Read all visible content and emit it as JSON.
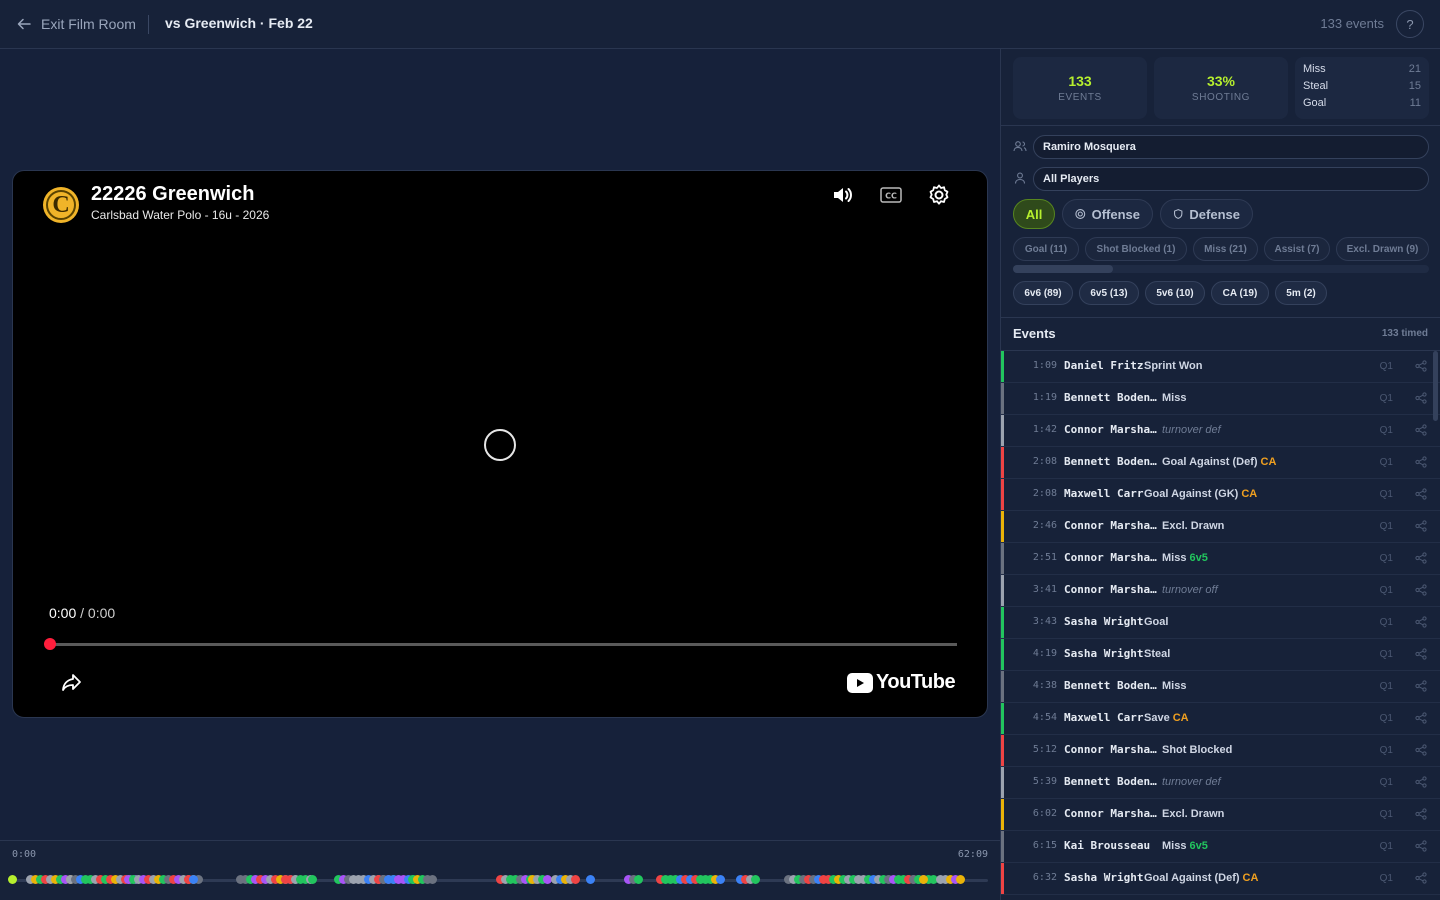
{
  "topbar": {
    "exit_label": "Exit Film Room",
    "game_title": "vs Greenwich · Feb 22",
    "events_count": "133 events",
    "help_label": "?"
  },
  "video": {
    "logo_letter": "C",
    "title": "22226 Greenwich",
    "subtitle": "Carlsbad Water Polo - 16u - 2026",
    "current_time": "0:00",
    "time_separator": "/",
    "duration": "0:00",
    "brand": "YouTube",
    "cc_label": "CC",
    "progress_fraction": 0
  },
  "timeline": {
    "start": "0:00",
    "end": "62:09"
  },
  "stats": {
    "events_value": "133",
    "events_label": "EVENTS",
    "shooting_value": "33%",
    "shooting_label": "SHOOTING",
    "breakdown": [
      {
        "name": "Miss",
        "count": "21"
      },
      {
        "name": "Steal",
        "count": "15"
      },
      {
        "name": "Goal",
        "count": "11"
      }
    ]
  },
  "filters": {
    "team_player": "Ramiro Mosquera",
    "player": "All Players"
  },
  "segments": {
    "all": "All",
    "offense": "Offense",
    "defense": "Defense"
  },
  "type_chips": [
    "Goal (11)",
    "Shot Blocked (1)",
    "Miss (21)",
    "Assist (7)",
    "Excl. Drawn (9)"
  ],
  "situation_chips": [
    "6v6 (89)",
    "6v5 (13)",
    "5v6 (10)",
    "CA (19)",
    "5m (2)"
  ],
  "events_header": {
    "title": "Events",
    "timed": "133 timed"
  },
  "colors": {
    "accent": "#b6ef2e",
    "green": "#22c55e",
    "red": "#ef4444",
    "amber": "#eab308",
    "gray": "#6b7280",
    "light_gray": "#9ca3af",
    "orange": "#f0a020"
  },
  "events": [
    {
      "time": "1:09",
      "player": "Daniel Fritz",
      "action": "Sprint Won",
      "tag": "",
      "tag_type": "",
      "italic": false,
      "quarter": "Q1",
      "color": "#22c55e"
    },
    {
      "time": "1:19",
      "player": "Bennett Boden…",
      "action": "Miss",
      "tag": "",
      "tag_type": "",
      "italic": false,
      "quarter": "Q1",
      "color": "#6b7280"
    },
    {
      "time": "1:42",
      "player": "Connor Marsha…",
      "action": "turnover def",
      "tag": "",
      "tag_type": "",
      "italic": true,
      "quarter": "Q1",
      "color": "#9ca3af"
    },
    {
      "time": "2:08",
      "player": "Bennett Boden…",
      "action": "Goal Against (Def)",
      "tag": "CA",
      "tag_type": "ca",
      "italic": false,
      "quarter": "Q1",
      "color": "#ef4444"
    },
    {
      "time": "2:08",
      "player": "Maxwell Carr",
      "action": "Goal Against (GK)",
      "tag": "CA",
      "tag_type": "ca",
      "italic": false,
      "quarter": "Q1",
      "color": "#ef4444"
    },
    {
      "time": "2:46",
      "player": "Connor Marsha…",
      "action": "Excl. Drawn",
      "tag": "",
      "tag_type": "",
      "italic": false,
      "quarter": "Q1",
      "color": "#eab308"
    },
    {
      "time": "2:51",
      "player": "Connor Marsha…",
      "action": "Miss",
      "tag": "6v5",
      "tag_type": "man",
      "italic": false,
      "quarter": "Q1",
      "color": "#6b7280"
    },
    {
      "time": "3:41",
      "player": "Connor Marsha…",
      "action": "turnover off",
      "tag": "",
      "tag_type": "",
      "italic": true,
      "quarter": "Q1",
      "color": "#9ca3af"
    },
    {
      "time": "3:43",
      "player": "Sasha Wright",
      "action": "Goal",
      "tag": "",
      "tag_type": "",
      "italic": false,
      "quarter": "Q1",
      "color": "#22c55e"
    },
    {
      "time": "4:19",
      "player": "Sasha Wright",
      "action": "Steal",
      "tag": "",
      "tag_type": "",
      "italic": false,
      "quarter": "Q1",
      "color": "#22c55e"
    },
    {
      "time": "4:38",
      "player": "Bennett Boden…",
      "action": "Miss",
      "tag": "",
      "tag_type": "",
      "italic": false,
      "quarter": "Q1",
      "color": "#6b7280"
    },
    {
      "time": "4:54",
      "player": "Maxwell Carr",
      "action": "Save",
      "tag": "CA",
      "tag_type": "ca",
      "italic": false,
      "quarter": "Q1",
      "color": "#22c55e"
    },
    {
      "time": "5:12",
      "player": "Connor Marsha…",
      "action": "Shot Blocked",
      "tag": "",
      "tag_type": "",
      "italic": false,
      "quarter": "Q1",
      "color": "#ef4444"
    },
    {
      "time": "5:39",
      "player": "Bennett Boden…",
      "action": "turnover def",
      "tag": "",
      "tag_type": "",
      "italic": true,
      "quarter": "Q1",
      "color": "#9ca3af"
    },
    {
      "time": "6:02",
      "player": "Connor Marsha…",
      "action": "Excl. Drawn",
      "tag": "",
      "tag_type": "",
      "italic": false,
      "quarter": "Q1",
      "color": "#eab308"
    },
    {
      "time": "6:15",
      "player": "Kai Brousseau",
      "action": "Miss",
      "tag": "6v5",
      "tag_type": "man",
      "italic": false,
      "quarter": "Q1",
      "color": "#6b7280"
    },
    {
      "time": "6:32",
      "player": "Sasha Wright",
      "action": "Goal Against (Def)",
      "tag": "CA",
      "tag_type": "ca",
      "italic": false,
      "quarter": "Q1",
      "color": "#ef4444"
    }
  ]
}
